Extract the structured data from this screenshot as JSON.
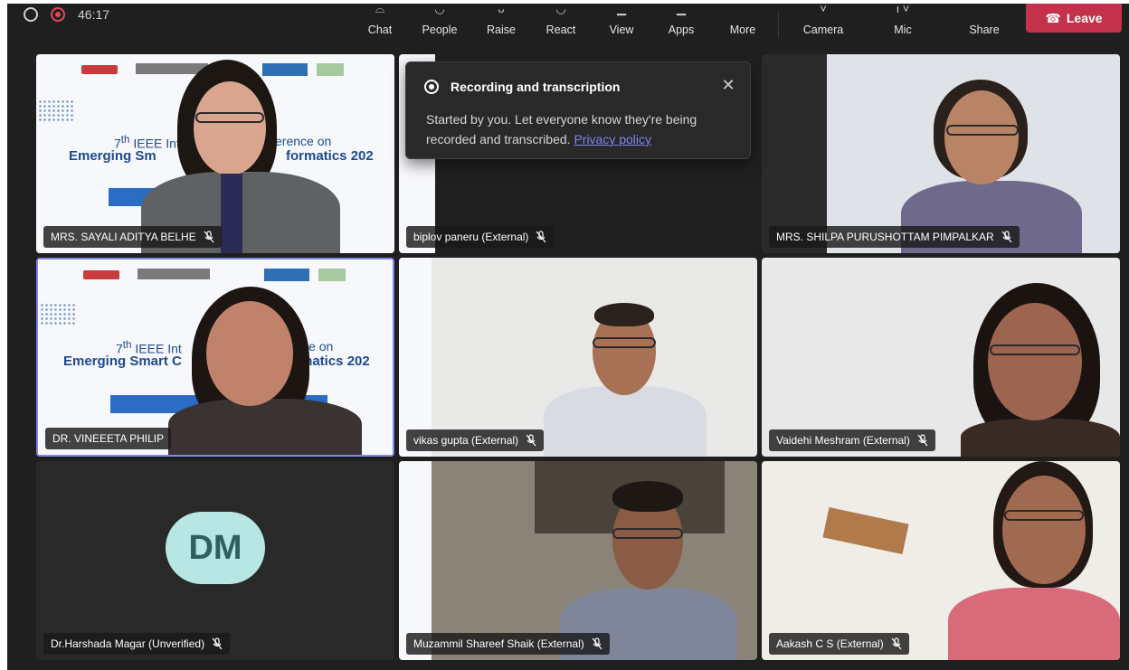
{
  "toolbar": {
    "timer": "46:17",
    "buttons": {
      "chat": "Chat",
      "people": "People",
      "raise": "Raise",
      "react": "React",
      "view": "View",
      "apps": "Apps",
      "more": "More",
      "camera": "Camera",
      "mic": "Mic",
      "share": "Share"
    },
    "leave": "Leave"
  },
  "notification": {
    "title": "Recording and transcription",
    "body": "Started by you. Let everyone know they're being recorded and transcribed.",
    "link": "Privacy policy",
    "close_icon": "close-icon"
  },
  "slide_text": {
    "line1_left": "7",
    "line1_sup": "th",
    "line1_mid": " IEEE Int",
    "line1_right": "erence on",
    "line2_left": "Emerging Sm",
    "line2_right": "formatics 202",
    "line2b_left": "Emerging Smart C",
    "line2b_right": "formatics 202"
  },
  "participants": [
    {
      "name": "MRS. SAYALI ADITYA BELHE"
    },
    {
      "name": "biplov paneru (External)"
    },
    {
      "name": "MRS. SHILPA PURUSHOTTAM PIMPALKAR"
    },
    {
      "name": "DR. VINEEETA PHILIP"
    },
    {
      "name": "vikas gupta (External)"
    },
    {
      "name": "Vaidehi Meshram (External)"
    },
    {
      "name": "Dr.Harshada Magar (Unverified)",
      "initials": "DM"
    },
    {
      "name": "Muzammil Shareef Shaik (External)"
    },
    {
      "name": "Aakash C S (External)"
    }
  ],
  "colors": {
    "stage_bg": "#1f1f1f",
    "leave": "#c4314b",
    "active_border": "#7f85f5",
    "avatar_bg": "#b8e6e4",
    "link": "#7f85f5"
  }
}
